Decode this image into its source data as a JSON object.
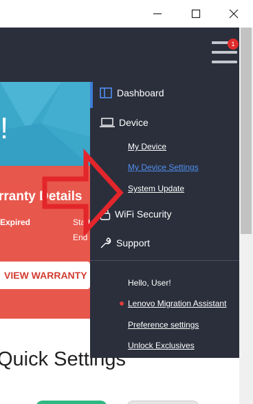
{
  "window": {
    "minimize_glyph": "—",
    "maximize_glyph": "☐",
    "close_glyph": "✕"
  },
  "menu": {
    "badge_count": "1"
  },
  "hero": {
    "exclamation": "!"
  },
  "warranty": {
    "title": "rranty Details",
    "status": "Expired",
    "start_label": "Start",
    "end_label": "End",
    "view_button": "VIEW WARRANTY"
  },
  "quick_settings": {
    "title": "Quick Settings"
  },
  "drawer": {
    "items": [
      {
        "label": "Dashboard",
        "icon": "dashboard-icon"
      },
      {
        "label": "Device",
        "icon": "laptop-icon"
      },
      {
        "label": "WiFi Security",
        "icon": "lock-icon"
      },
      {
        "label": "Support",
        "icon": "wrench-icon"
      }
    ],
    "device_links": [
      {
        "label": "My Device"
      },
      {
        "label": "My Device Settings",
        "active": true
      },
      {
        "label": "System Update"
      }
    ],
    "greeting": "Hello, User!",
    "account_links": [
      {
        "label": "Lenovo Migration Assistant",
        "new": true
      },
      {
        "label": "Preference settings"
      },
      {
        "label": "Unlock Exclusives"
      }
    ]
  },
  "colors": {
    "drawer_bg": "#2b2f3c",
    "hero_bg": "#3ba7c9",
    "warranty_bg": "#e8574c",
    "accent": "#3d7dd6",
    "active_link": "#4f8ff0",
    "alert_red": "#e02b2b",
    "annotation_arrow": "#e3262b"
  }
}
